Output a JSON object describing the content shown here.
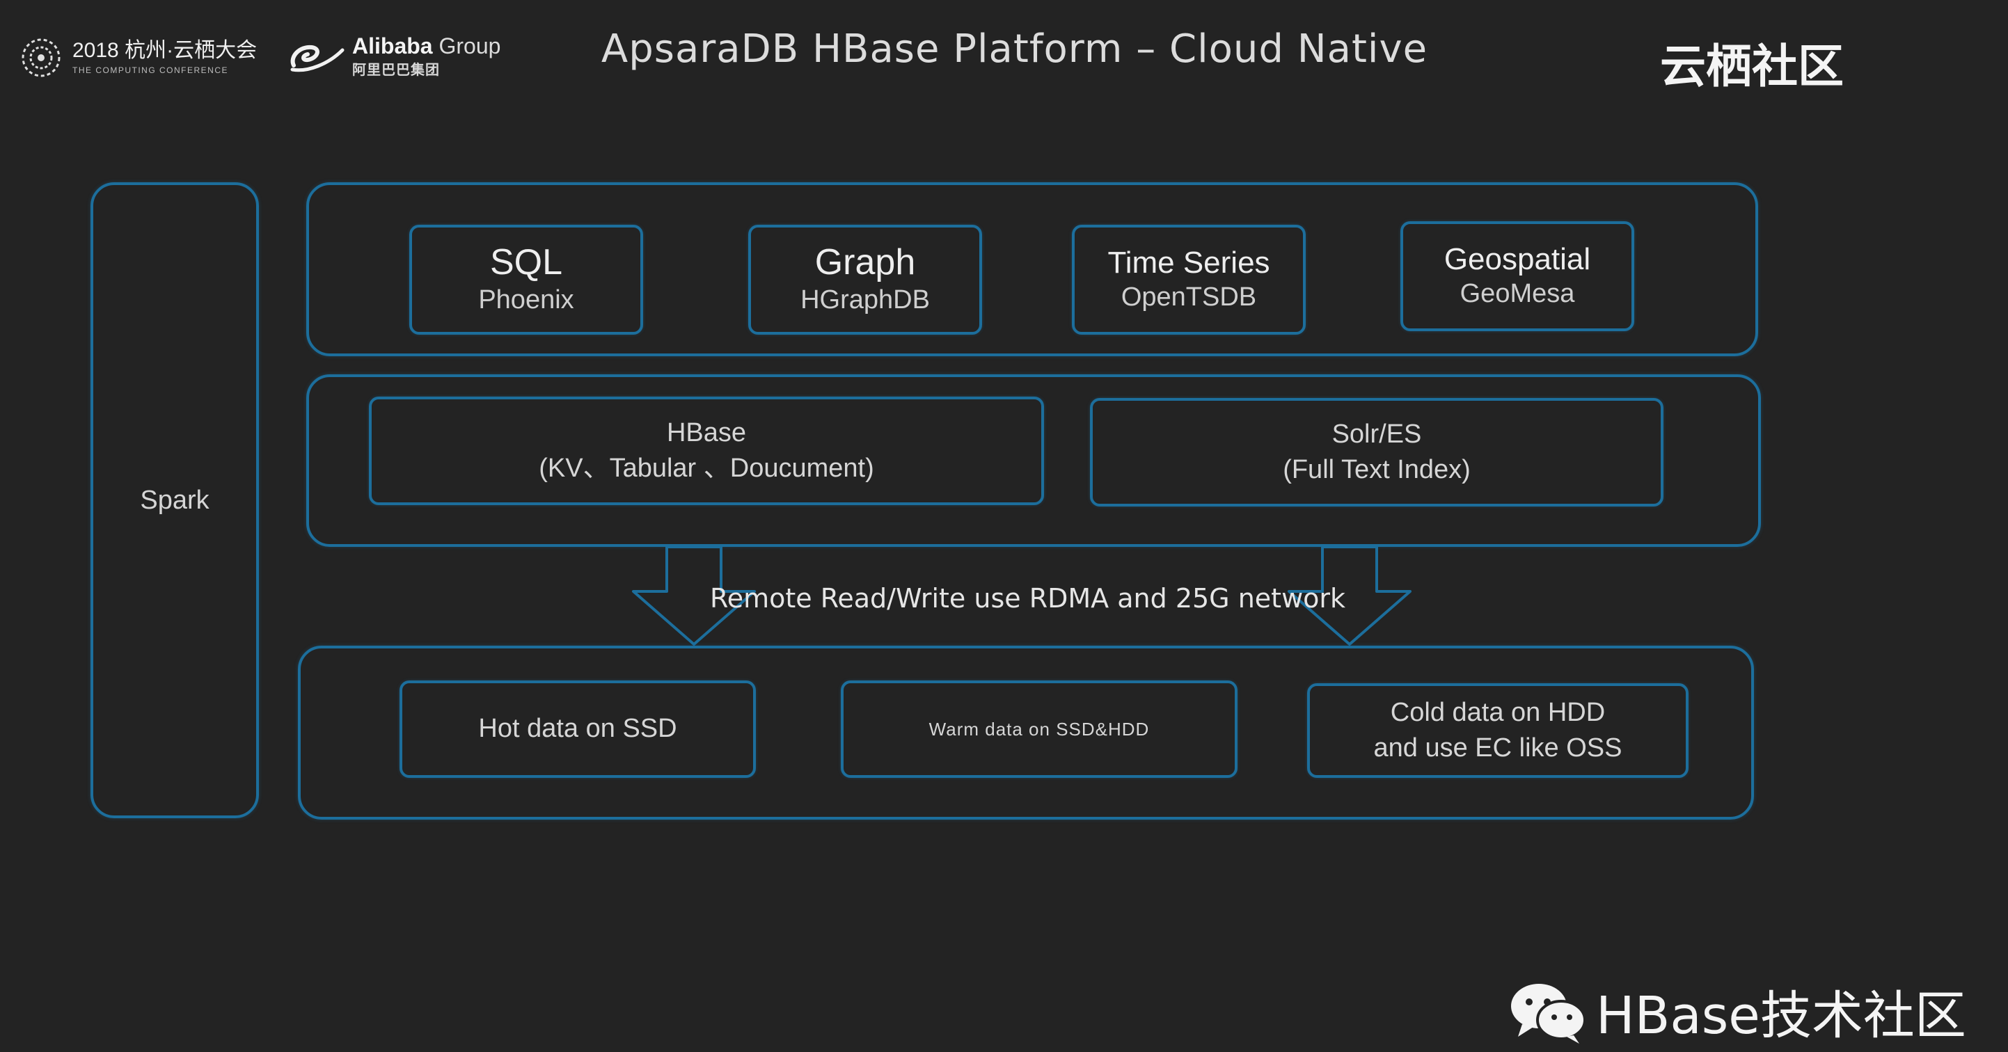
{
  "header": {
    "conference_main": "2018 杭州·云栖大会",
    "conference_sub": "THE COMPUTING CONFERENCE",
    "alibaba_name": "Alibaba",
    "alibaba_group": "Group",
    "alibaba_cn": "阿里巴巴集团",
    "title": "ApsaraDB HBase Platform – Cloud Native",
    "brand": "云栖社区"
  },
  "diagram": {
    "side": {
      "label": "Spark"
    },
    "engines": [
      {
        "title": "SQL",
        "subtitle": "Phoenix"
      },
      {
        "title": "Graph",
        "subtitle": "HGraphDB"
      },
      {
        "title": "Time Series",
        "subtitle": "OpenTSDB"
      },
      {
        "title": "Geospatial",
        "subtitle": "GeoMesa"
      }
    ],
    "core": [
      {
        "line1": "HBase",
        "line2": "(KV、Tabular 、Doucument)"
      },
      {
        "line1": "Solr/ES",
        "line2": "(Full Text Index)"
      }
    ],
    "connector_label": "Remote Read/Write  use RDMA and 25G network",
    "storage": [
      {
        "line1": "Hot data on SSD"
      },
      {
        "line1": "Warm data on SSD&HDD"
      },
      {
        "line1": "Cold data on HDD",
        "line2": "and use EC like OSS"
      }
    ]
  },
  "footer": {
    "text": "HBase技术社区"
  },
  "colors": {
    "background": "#232323",
    "box_border": "#1c6e9c",
    "text": "#e8e8e8"
  }
}
